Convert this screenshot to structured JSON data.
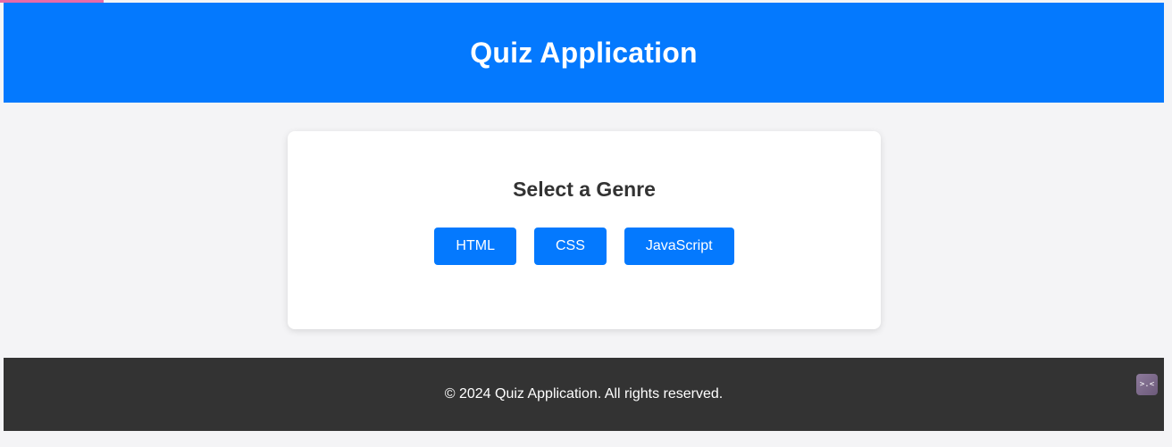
{
  "header": {
    "title": "Quiz Application"
  },
  "main": {
    "heading": "Select a Genre",
    "genres": [
      {
        "label": "HTML"
      },
      {
        "label": "CSS"
      },
      {
        "label": "JavaScript"
      }
    ]
  },
  "footer": {
    "text": "© 2024 Quiz Application. All rights reserved."
  },
  "widgets": {
    "corner_icon": "terminal-face-icon",
    "corner_glyph": ">.<"
  },
  "colors": {
    "primary": "#0479fe",
    "footer_bg": "#333333",
    "page_bg": "#f4f4f6",
    "heading_text": "#333333",
    "accent_strip": "#e86aa8"
  }
}
